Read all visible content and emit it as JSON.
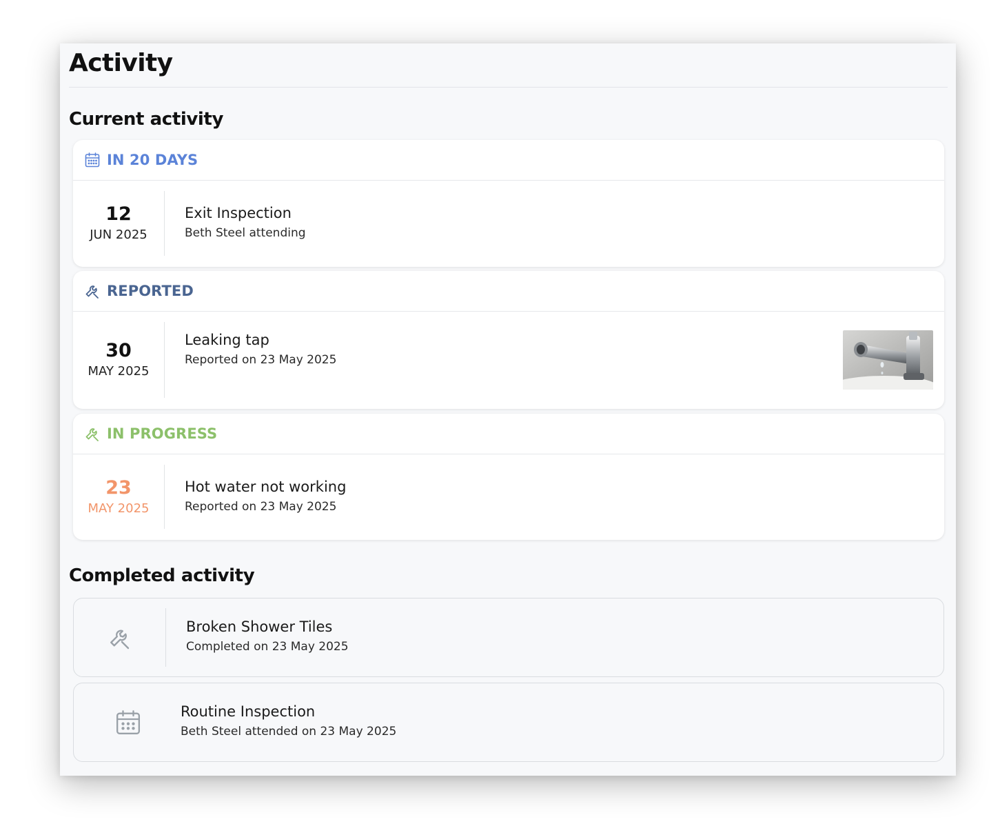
{
  "page_title": "Activity",
  "current": {
    "heading": "Current activity",
    "items": [
      {
        "status": "IN 20 DAYS",
        "status_icon": "calendar-icon",
        "status_color": "#5b83d8",
        "day": "12",
        "month": "JUN 2025",
        "title": "Exit Inspection",
        "subtitle": "Beth Steel attending"
      },
      {
        "status": "REPORTED",
        "status_icon": "wrench-icon",
        "status_color": "#4a6591",
        "day": "30",
        "month": "MAY 2025",
        "title": "Leaking tap",
        "subtitle": "Reported on 23 May 2025",
        "has_photo": true
      },
      {
        "status": "IN PROGRESS",
        "status_icon": "wrench-icon",
        "status_color": "#8cc06a",
        "day": "23",
        "month": "MAY 2025",
        "date_color": "#f2956a",
        "title": "Hot water not working",
        "subtitle": "Reported on 23 May 2025"
      }
    ]
  },
  "completed": {
    "heading": "Completed activity",
    "items": [
      {
        "icon": "wrench-icon",
        "title": "Broken Shower Tiles",
        "subtitle": "Completed on 23 May 2025"
      },
      {
        "icon": "calendar-icon",
        "title": "Routine Inspection",
        "subtitle": "Beth Steel attended on 23 May 2025"
      }
    ]
  }
}
